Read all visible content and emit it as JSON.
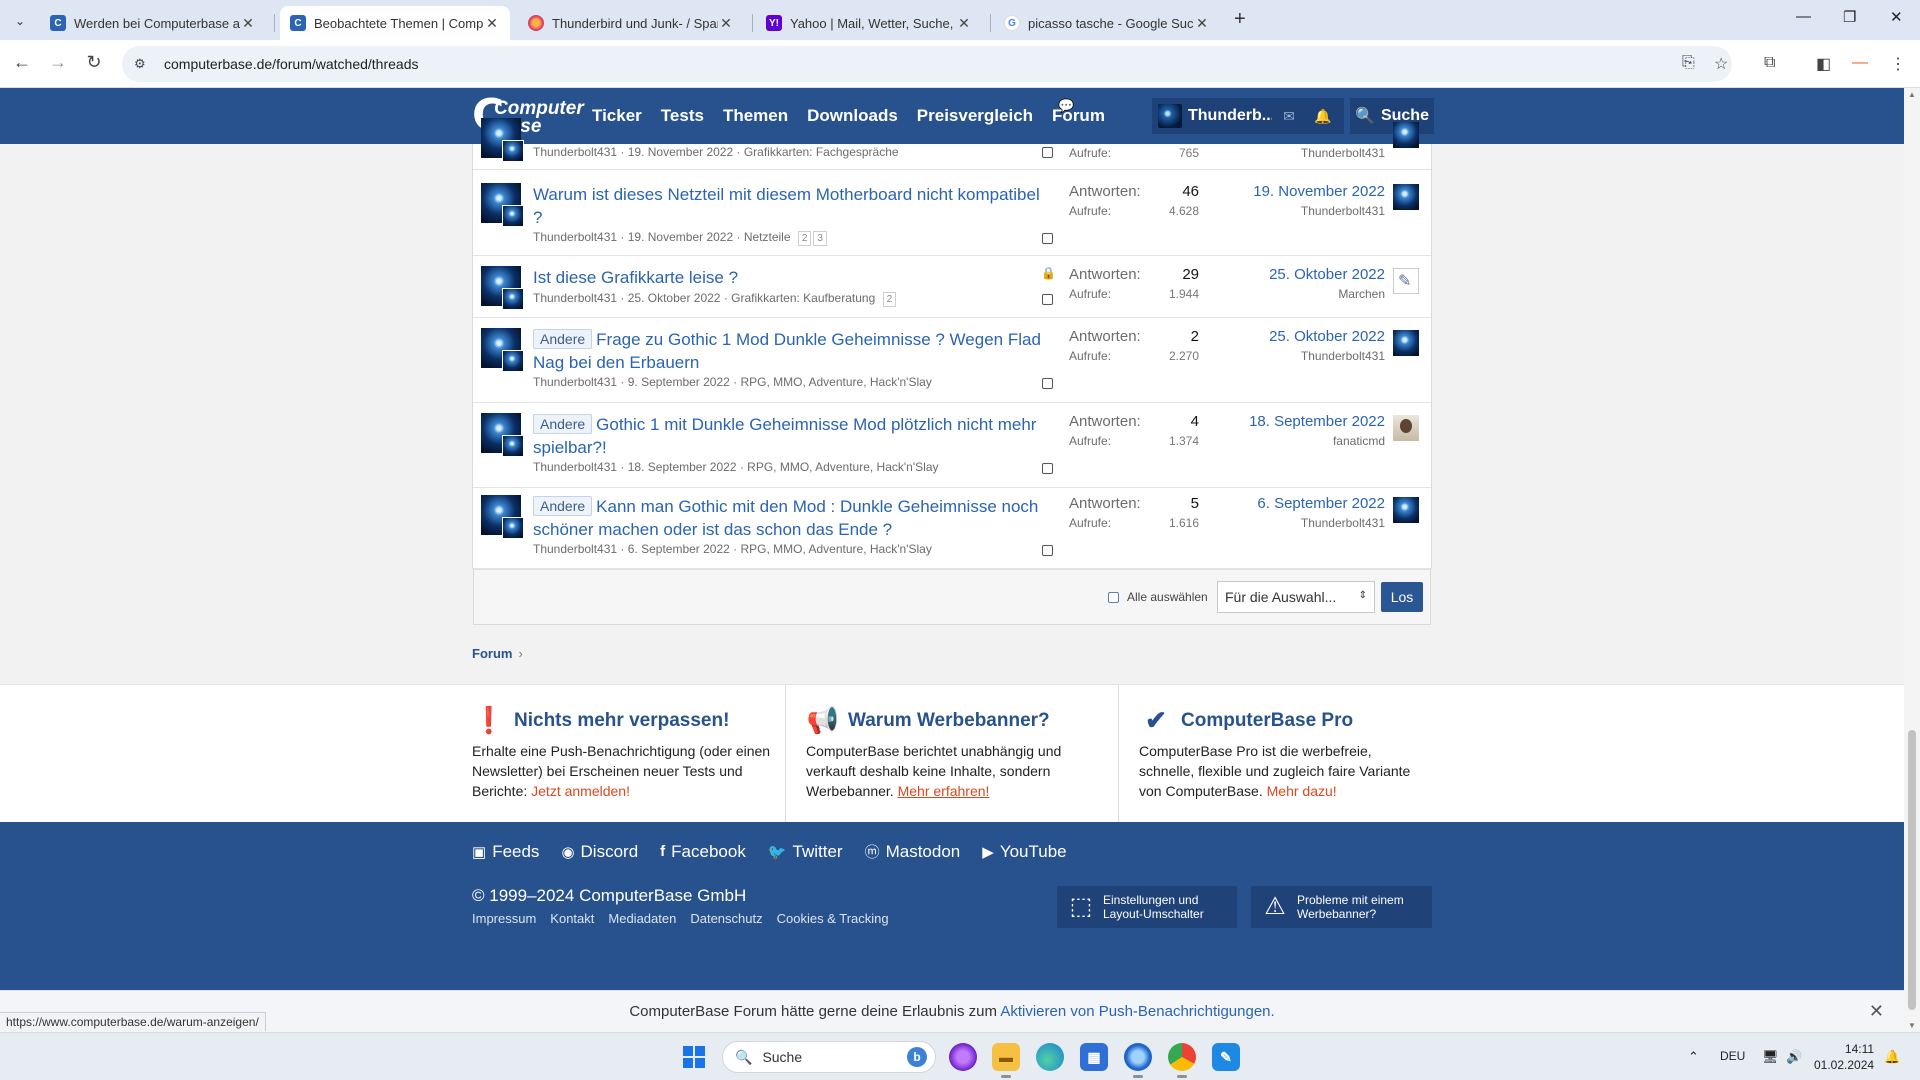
{
  "browser": {
    "tabs": [
      {
        "title": "Werden bei Computerbase alte",
        "favicon": "cb-icon",
        "active": false
      },
      {
        "title": "Beobachtete Themen | Comput",
        "favicon": "cb-icon",
        "active": true
      },
      {
        "title": "Thunderbird und Junk- / Spam",
        "favicon": "firefox-icon",
        "active": false
      },
      {
        "title": "Yahoo | Mail, Wetter, Suche, Na",
        "favicon": "yahoo-icon",
        "active": false
      },
      {
        "title": "picasso tasche - Google Suche",
        "favicon": "google-icon",
        "active": false
      }
    ],
    "url": "computerbase.de/forum/watched/threads"
  },
  "site": {
    "logo_line1": "Computer",
    "logo_line2": "Base",
    "nav": [
      "Ticker",
      "Tests",
      "Themen",
      "Downloads",
      "Preisvergleich",
      "Forum"
    ],
    "username": "Thunderb...",
    "search_label": "Suche"
  },
  "stats_labels": {
    "replies": "Antworten:",
    "views": "Aufrufe:"
  },
  "threads": [
    {
      "prefix": "",
      "title": "",
      "author": "Thunderbolt431",
      "date": "19. November 2022",
      "forum": "Grafikkarten: Fachgespräche",
      "pages": [],
      "locked": false,
      "replies": "",
      "views": "765",
      "last_date": "",
      "last_user": "Thunderbolt431"
    },
    {
      "prefix": "",
      "title": "Warum ist dieses Netzteil mit diesem Motherboard nicht kompatibel ?",
      "author": "Thunderbolt431",
      "date": "19. November 2022",
      "forum": "Netzteile",
      "pages": [
        "2",
        "3"
      ],
      "locked": false,
      "replies": "46",
      "views": "4.628",
      "last_date": "19. November 2022",
      "last_user": "Thunderbolt431"
    },
    {
      "prefix": "",
      "title": "Ist diese Grafikkarte leise ?",
      "author": "Thunderbolt431",
      "date": "25. Oktober 2022",
      "forum": "Grafikkarten: Kaufberatung",
      "pages": [
        "2"
      ],
      "locked": true,
      "replies": "29",
      "views": "1.944",
      "last_date": "25. Oktober 2022",
      "last_user": "Marchen"
    },
    {
      "prefix": "Andere",
      "title": "Frage zu Gothic 1 Mod Dunkle Geheimnisse ? Wegen Flad Nag bei den Erbauern",
      "author": "Thunderbolt431",
      "date": "9. September 2022",
      "forum": "RPG, MMO, Adventure, Hack'n'Slay",
      "pages": [],
      "locked": false,
      "replies": "2",
      "views": "2.270",
      "last_date": "25. Oktober 2022",
      "last_user": "Thunderbolt431"
    },
    {
      "prefix": "Andere",
      "title": "Gothic 1 mit Dunkle Geheimnisse Mod plötzlich nicht mehr spielbar?!",
      "author": "Thunderbolt431",
      "date": "18. September 2022",
      "forum": "RPG, MMO, Adventure, Hack'n'Slay",
      "pages": [],
      "locked": false,
      "replies": "4",
      "views": "1.374",
      "last_date": "18. September 2022",
      "last_user": "fanaticmd"
    },
    {
      "prefix": "Andere",
      "title": "Kann man Gothic mit den Mod : Dunkle Geheimnisse noch schöner machen oder ist das schon das Ende ?",
      "author": "Thunderbolt431",
      "date": "6. September 2022",
      "forum": "RPG, MMO, Adventure, Hack'n'Slay",
      "pages": [],
      "locked": false,
      "replies": "5",
      "views": "1.616",
      "last_date": "6. September 2022",
      "last_user": "Thunderbolt431"
    }
  ],
  "list_footer": {
    "select_all": "Alle auswählen",
    "action_select": "Für die Auswahl...",
    "go_button": "Los"
  },
  "breadcrumb": "Forum",
  "info": [
    {
      "heading": "Nichts mehr verpassen!",
      "icon": "exclamation-icon",
      "text": "Erhalte eine Push-Benachrichtigung (oder einen Newsletter) bei Erscheinen neuer Tests und Berichte: ",
      "link": "Jetzt anmelden!"
    },
    {
      "heading": "Warum Werbebanner?",
      "icon": "megaphone-icon",
      "text": "ComputerBase berichtet unabhängig und verkauft deshalb keine Inhalte, sondern Werbebanner. ",
      "link": "Mehr erfahren!"
    },
    {
      "heading": "ComputerBase Pro",
      "icon": "checkmark-icon",
      "text": "ComputerBase Pro ist die werbefreie, schnelle, flexible und zugleich faire Variante von ComputerBase. ",
      "link": "Mehr dazu!"
    }
  ],
  "footer": {
    "social": [
      {
        "label": "Feeds",
        "icon": "rss-icon"
      },
      {
        "label": "Discord",
        "icon": "discord-icon"
      },
      {
        "label": "Facebook",
        "icon": "facebook-icon"
      },
      {
        "label": "Twitter",
        "icon": "twitter-icon"
      },
      {
        "label": "Mastodon",
        "icon": "mastodon-icon"
      },
      {
        "label": "YouTube",
        "icon": "youtube-icon"
      }
    ],
    "copyright": "© 1999–2024 ComputerBase GmbH",
    "links": [
      "Impressum",
      "Kontakt",
      "Mediadaten",
      "Datenschutz",
      "Cookies & Tracking"
    ],
    "btn_settings": [
      "Einstellungen und",
      "Layout-Umschalter"
    ],
    "btn_problems": [
      "Probleme mit einem",
      "Werbebanner?"
    ]
  },
  "push_bar": {
    "text": "ComputerBase Forum hätte gerne deine Erlaubnis zum ",
    "link": "Aktivieren von Push-Benachrichtigungen."
  },
  "status_url": "https://www.computerbase.de/warum-anzeigen/",
  "taskbar": {
    "search_placeholder": "Suche",
    "language": "DEU",
    "time": "14:11",
    "date": "01.02.2024"
  },
  "colors": {
    "brand_blue": "#28528d",
    "link_blue": "#2a64b2",
    "accent_orange": "#e0461d"
  }
}
